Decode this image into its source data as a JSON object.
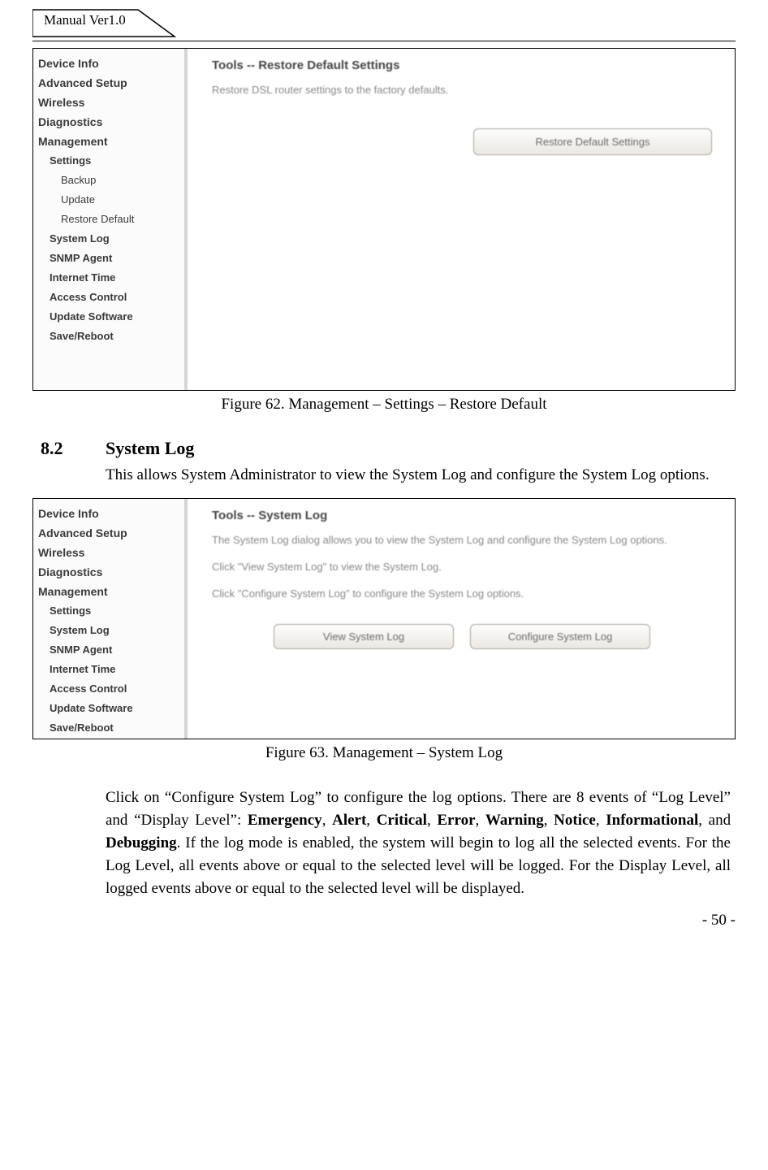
{
  "header": {
    "doc_version": "Manual Ver1.0"
  },
  "fig62": {
    "nav": {
      "items": [
        "Device Info",
        "Advanced Setup",
        "Wireless",
        "Diagnostics",
        "Management"
      ],
      "sub1": [
        "Settings"
      ],
      "sub2": [
        "Backup",
        "Update",
        "Restore Default"
      ],
      "sub1b": [
        "System Log",
        "SNMP Agent",
        "Internet Time",
        "Access Control",
        "Update Software",
        "Save/Reboot"
      ]
    },
    "content": {
      "title": "Tools -- Restore Default Settings",
      "text": "Restore DSL router settings to the factory defaults.",
      "button": "Restore Default Settings"
    }
  },
  "caption62": "Figure 62. Management – Settings – Restore Default",
  "section": {
    "num": "8.2",
    "title": "System Log"
  },
  "section_body": "This allows System Administrator to view the System Log and configure the System Log options.",
  "fig63": {
    "nav": {
      "items": [
        "Device Info",
        "Advanced Setup",
        "Wireless",
        "Diagnostics",
        "Management"
      ],
      "sub1": [
        "Settings",
        "System Log",
        "SNMP Agent",
        "Internet Time",
        "Access Control",
        "Update Software",
        "Save/Reboot"
      ]
    },
    "content": {
      "title": "Tools -- System Log",
      "line1": "The System Log dialog allows you to view the System Log and configure the System Log options.",
      "line2": "Click \"View System Log\" to view the System Log.",
      "line3": "Click \"Configure System Log\" to configure the System Log options.",
      "btn1": "View System Log",
      "btn2": "Configure System Log"
    }
  },
  "caption63": "Figure 63. Management – System Log",
  "para2": {
    "lead": "Click on “Configure System Log” to configure the log options. There are 8 events of “Log Level” and “Display Level”: ",
    "levels": [
      "Emergency",
      "Alert",
      "Critical",
      "Error",
      "Warning",
      "Notice",
      "Informational",
      "Debugging"
    ],
    "sep": ", ",
    "and": ", and ",
    "tail": ". If the log mode is enabled, the system will begin to log all the selected events. For the Log Level, all events above or equal to the selected level will be logged. For the Display Level, all logged events above or equal to the selected level will be displayed."
  },
  "page_number": "- 50 -"
}
